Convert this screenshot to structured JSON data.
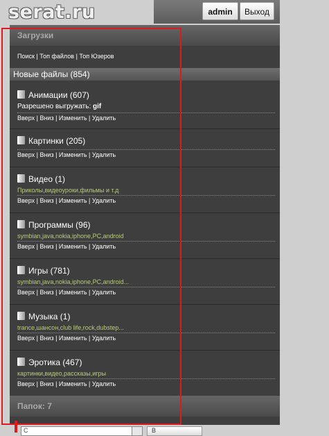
{
  "site": {
    "logo": "serat.ru"
  },
  "userbar": {
    "admin": "admin",
    "logout": "Выход"
  },
  "downloads_header": "Загрузки",
  "nav": {
    "search": "Поиск",
    "top_files": "Топ файлов",
    "top_users": "Топ Юзеров",
    "sep": " | "
  },
  "new_files": "Новые файлы (854)",
  "actions": {
    "up": "Вверх",
    "down": "Вниз",
    "edit": "Изменить",
    "delete": "Удалить",
    "sep": " | "
  },
  "categories": [
    {
      "title": "Анимации (607)",
      "desc_prefix": "Разрешено выгружать: ",
      "desc_bold": "gif"
    },
    {
      "title": "Картинки (205)"
    },
    {
      "title": "Видео (1)",
      "desc": "Приколы,видеоуроки,фильмы и т.д"
    },
    {
      "title": "Программы (96)",
      "desc": "symbian,java,nokia,iphone,PC,android"
    },
    {
      "title": "Игры (781)",
      "desc": "symbian,java,nokia,iphone,PC,android..."
    },
    {
      "title": "Музыка (1)",
      "desc": "trance,шансон,club life,rock,dubstep..."
    },
    {
      "title": "Эротика (467)",
      "desc": "картинки,видео,рассказы,игры"
    }
  ],
  "folders_footer": "Папок: 7",
  "bottom": {
    "input_value": "С",
    "button_label": "В"
  },
  "colors": {
    "highlight": "#e0191c",
    "desc_green": "#b9cc7c"
  }
}
